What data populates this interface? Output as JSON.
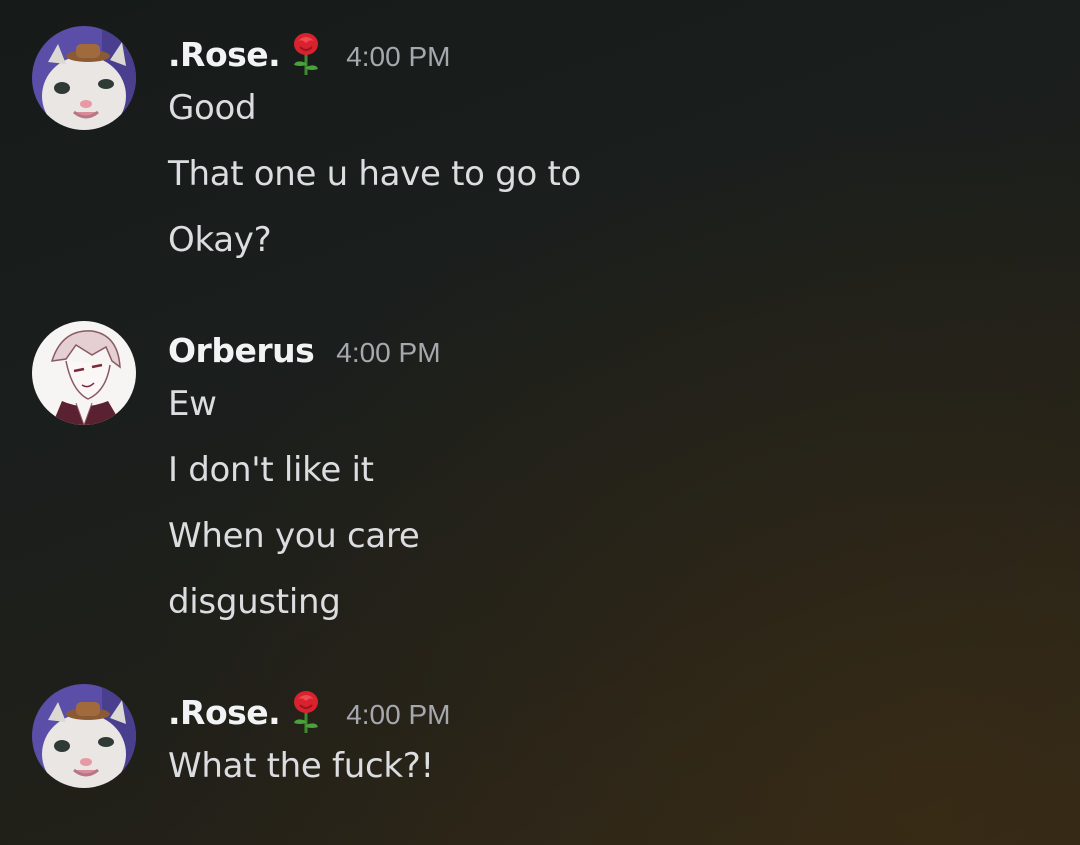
{
  "messages": [
    {
      "username": ".Rose.",
      "emoji": "rose-icon",
      "timestamp": "4:00 PM",
      "lines": [
        "Good",
        "That one u have to go to",
        "Okay?"
      ]
    },
    {
      "username": "Orberus",
      "timestamp": "4:00 PM",
      "lines": [
        "Ew",
        "I don't like it",
        "When you care",
        "disgusting"
      ]
    },
    {
      "username": ".Rose.",
      "emoji": "rose-icon",
      "timestamp": "4:00 PM",
      "lines": [
        "What the fuck?!"
      ]
    }
  ],
  "colors": {
    "username": "#f2f3f5",
    "message_text": "#dcdde0",
    "timestamp": "#a5a8ad",
    "background_top": "#161b1a",
    "background_bottom": "#2e2618"
  }
}
